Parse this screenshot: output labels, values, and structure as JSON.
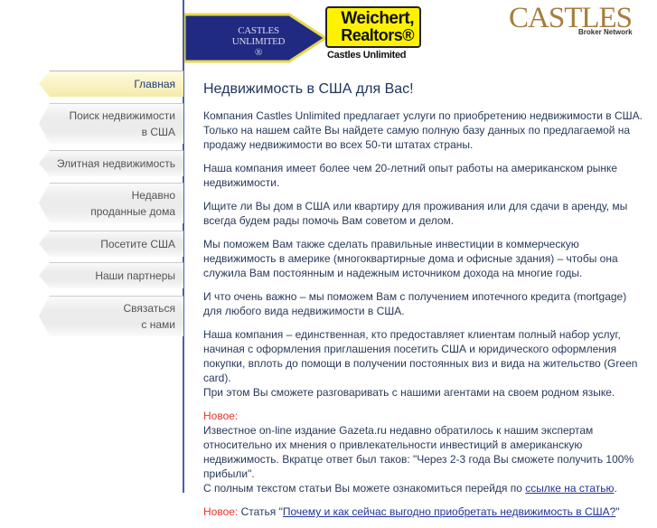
{
  "header": {
    "banner_logo": "CASTLES UNLIMITED ®",
    "weichert_line1": "Weichert,",
    "weichert_line2": "Realtors®",
    "weichert_sub": "Castles Unlimited",
    "castles_logo": "CASTLES",
    "castles_sub": "Broker Network"
  },
  "nav": {
    "items": [
      {
        "label": "Главная"
      },
      {
        "label": "Поиск недвижимости",
        "label2": "в США"
      },
      {
        "label": "Элитная недвижимость"
      },
      {
        "label": "Недавно",
        "label2": "проданные дома"
      },
      {
        "label": "Посетите США"
      },
      {
        "label": "Наши партнеры"
      },
      {
        "label": "Связаться",
        "label2": "с нами"
      }
    ]
  },
  "main": {
    "title": "Недвижимость в США для Вас!",
    "p1": "Компания Castles Unlimited предлагает услуги по приобретению недвижимости в США. Только на нашем сайте Вы найдете самую полную базу данных по предлагаемой на продажу недвижимости во всех 50-ти штатах страны.",
    "p2": "Наша компания имеет более чем 20-летний опыт работы на американском рынке недвижимости.",
    "p3": "Ищите ли Вы дом в США или квартиру для проживания или для сдачи в аренду, мы всегда будем рады помочь Вам советом и делом.",
    "p4": "Мы поможем Вам также сделать правильные инвестиции в коммерческую недвижимость в америке (многоквартирные дома и офисные здания) – чтобы она служила Вам постоянным и надежным источником дохода на многие годы.",
    "p5": "И что очень важно – мы поможем Вам с получением ипотечного кредита (mortgage) для любого вида недвижимости в США.",
    "p6a": "Наша компания – единственная, кто предоставляет клиентам полный набор услуг, начиная с оформления приглашения посетить США и юридического оформления покупки, вплоть до помощи в получении постоянных виз и вида на жительство (Green card).",
    "p6b": "При этом Вы сможете разговаривать с нашими агентами на своем родном языке.",
    "new_label": "Новое:",
    "news1": "Известное on-line издание Gazeta.ru недавно обратилось к нашим экспертам относительно их мнения о привлекательности инвестиций в американскую недвижимость. Вкратце ответ был таков: \"Через 2-3 года Вы сможете получить 100% прибыли\".",
    "news1b": "С полным текстом статьи Вы можете ознакомиться перейдя по",
    "news1_link": "ссылке на статью",
    "news2_prefix": "Статья \"",
    "news2_link": "Почему и как сейчас выгодно приобретать недвижимость в США?",
    "news2_suffix": "\""
  }
}
